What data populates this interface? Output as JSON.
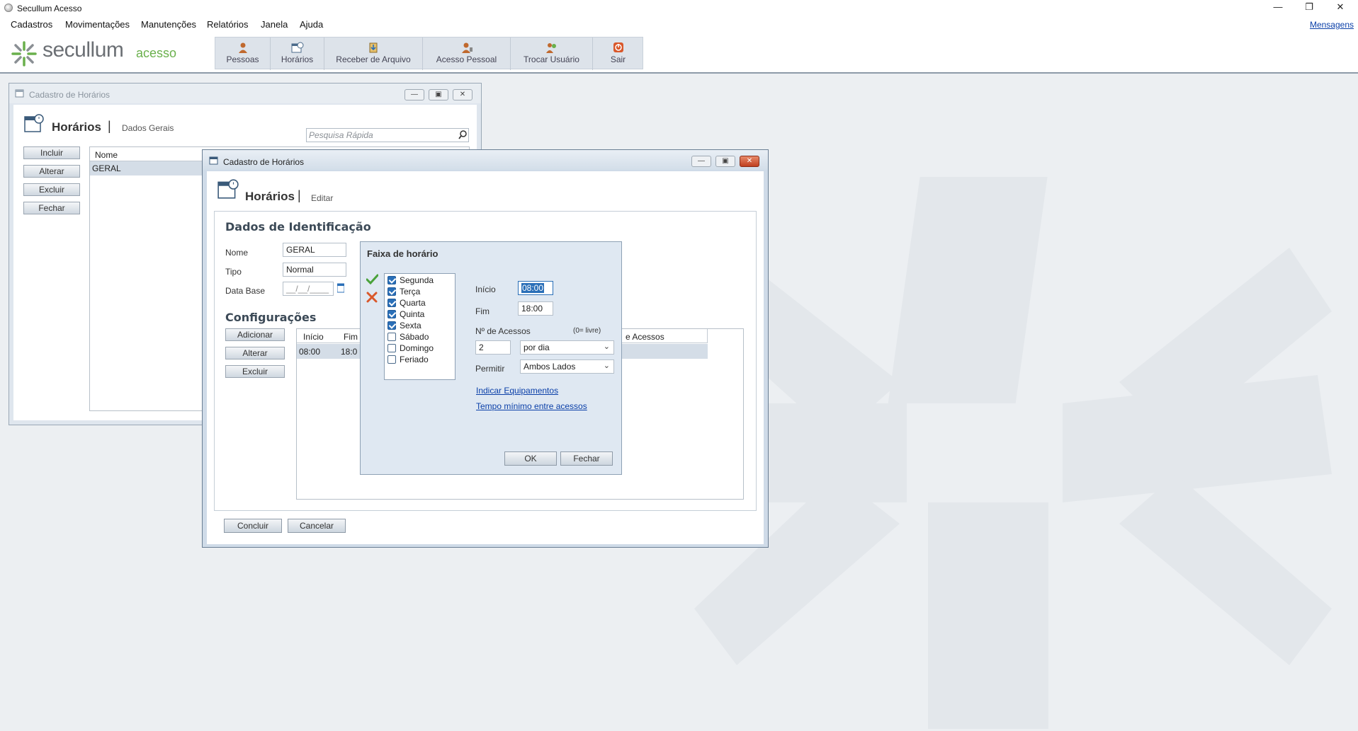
{
  "app": {
    "title": "Secullum Acesso"
  },
  "menu": {
    "items": [
      "Cadastros",
      "Movimentações",
      "Manutenções",
      "Relatórios",
      "Janela",
      "Ajuda"
    ],
    "mensagens": "Mensagens"
  },
  "logo": {
    "brand": "secullum",
    "sub": "acesso"
  },
  "toolbar": {
    "pessoas": "Pessoas",
    "horarios": "Horários",
    "receber": "Receber de Arquivo",
    "acesso": "Acesso Pessoal",
    "trocar": "Trocar Usuário",
    "sair": "Sair"
  },
  "window_bg": {
    "title": "Cadastro de Horários",
    "header": "Horários",
    "sub": "Dados Gerais",
    "search_placeholder": "Pesquisa Rápida",
    "buttons": {
      "incluir": "Incluir",
      "alterar": "Alterar",
      "excluir": "Excluir",
      "fechar": "Fechar"
    },
    "grid": {
      "col_nome": "Nome",
      "row1": "GERAL"
    }
  },
  "window_edit": {
    "title": "Cadastro de Horários",
    "header": "Horários",
    "sub": "Editar",
    "section_id": "Dados de Identificação",
    "nome_label": "Nome",
    "nome_value": "GERAL",
    "tipo_label": "Tipo",
    "tipo_value": "Normal",
    "database_label": "Data Base",
    "database_value": "__/__/____",
    "section_config": "Configurações",
    "buttons": {
      "adicionar": "Adicionar",
      "alterar": "Alterar",
      "excluir": "Excluir",
      "concluir": "Concluir",
      "cancelar": "Cancelar"
    },
    "grid": {
      "col_inicio": "Início",
      "col_fim": "Fim",
      "col_acessos": "e Acessos",
      "row_inicio": "08:00",
      "row_fim": "18:0"
    }
  },
  "faixa": {
    "title": "Faixa de horário",
    "days": [
      {
        "label": "Segunda",
        "checked": true
      },
      {
        "label": "Terça",
        "checked": true
      },
      {
        "label": "Quarta",
        "checked": true
      },
      {
        "label": "Quinta",
        "checked": true
      },
      {
        "label": "Sexta",
        "checked": true
      },
      {
        "label": "Sábado",
        "checked": false
      },
      {
        "label": "Domingo",
        "checked": false
      },
      {
        "label": "Feriado",
        "checked": false
      }
    ],
    "inicio_label": "Início",
    "inicio_value": "08:00",
    "fim_label": "Fim",
    "fim_value": "18:00",
    "acessos_label": "Nº de Acessos",
    "acessos_hint": "(0= livre)",
    "acessos_value": "2",
    "periodo": "por dia",
    "permitir_label": "Permitir",
    "permitir_value": "Ambos Lados",
    "link_equip": "Indicar Equipamentos",
    "link_tempo": "Tempo mínimo entre acessos",
    "ok": "OK",
    "fechar": "Fechar"
  },
  "colors": {
    "accent": "#2a6fb8",
    "brand_green": "#6ab04c",
    "link": "#0a3fa8"
  }
}
